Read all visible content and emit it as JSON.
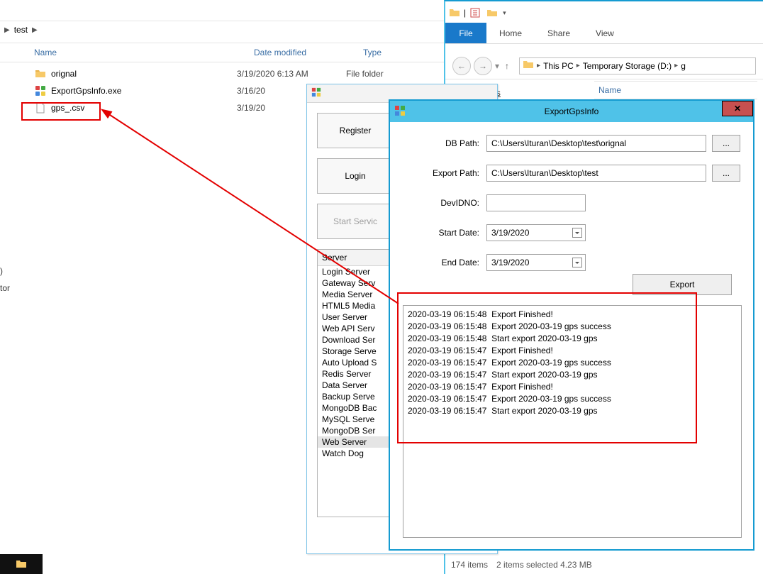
{
  "explorer_left": {
    "breadcrumb": "test",
    "columns": {
      "name": "Name",
      "date": "Date modified",
      "type": "Type"
    },
    "rows": [
      {
        "icon": "folder",
        "name": "orignal",
        "date": "3/19/2020 6:13 AM",
        "type": "File folder"
      },
      {
        "icon": "exe",
        "name": "ExportGpsInfo.exe",
        "date": "3/16/20",
        "type": ""
      },
      {
        "icon": "file",
        "name": "gps_.csv",
        "date": "3/19/20",
        "type": ""
      }
    ],
    "sidebar_clip": [
      ")",
      "tor"
    ]
  },
  "explorer_right": {
    "ribbon": {
      "file": "File",
      "home": "Home",
      "share": "Share",
      "view": "View"
    },
    "address_parts": [
      "This PC",
      "Temporary Storage (D:)",
      "g"
    ],
    "fav_header": "Favorites",
    "col_name": "Name",
    "status_items": "174 items",
    "status_sel": "2 items selected  4.23 MB"
  },
  "server_ctl": {
    "buttons": {
      "register": "Register",
      "login": "Login",
      "start": "Start Servic"
    },
    "list_header": "Server",
    "items": [
      "Login Server",
      "Gateway Serv",
      "Media Server",
      "HTML5 Media",
      "User Server",
      "Web API Serv",
      "Download Ser",
      "Storage Serve",
      "Auto Upload S",
      "Redis Server",
      "Data Server",
      "Backup Serve",
      "MongoDB Bac",
      "MySQL Serve",
      "MongoDB Ser",
      "Web Server",
      "Watch Dog"
    ],
    "selected_index": 15
  },
  "export_win": {
    "title": "ExportGpsInfo",
    "labels": {
      "db": "DB Path:",
      "export": "Export Path:",
      "dev": "DevIDNO:",
      "start": "Start Date:",
      "end": "End Date:",
      "button": "Export",
      "dots": "..."
    },
    "values": {
      "db": "C:\\Users\\Ituran\\Desktop\\test\\orignal",
      "export": "C:\\Users\\Ituran\\Desktop\\test",
      "dev": "",
      "start": "3/19/2020",
      "end": "3/19/2020"
    },
    "log": "2020-03-19 06:15:48  Export Finished!\n2020-03-19 06:15:48  Export 2020-03-19 gps success\n2020-03-19 06:15:48  Start export 2020-03-19 gps\n2020-03-19 06:15:47  Export Finished!\n2020-03-19 06:15:47  Export 2020-03-19 gps success\n2020-03-19 06:15:47  Start export 2020-03-19 gps\n2020-03-19 06:15:47  Export Finished!\n2020-03-19 06:15:47  Export 2020-03-19 gps success\n2020-03-19 06:15:47  Start export 2020-03-19 gps"
  }
}
